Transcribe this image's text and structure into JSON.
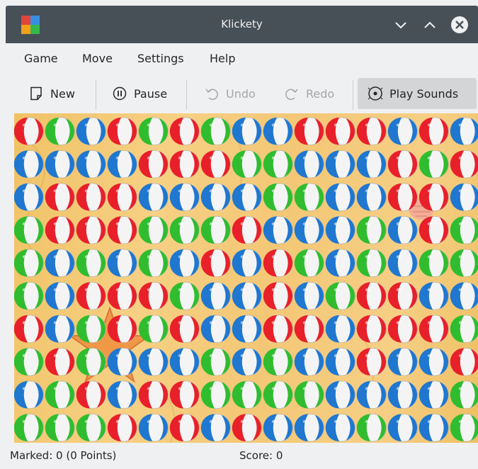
{
  "window": {
    "title": "Klickety",
    "titlebar_color": "#475057",
    "controls": [
      "minimize-icon",
      "maximize-icon",
      "close-icon"
    ]
  },
  "menubar": {
    "items": [
      {
        "label": "Game"
      },
      {
        "label": "Move"
      },
      {
        "label": "Settings"
      },
      {
        "label": "Help"
      }
    ]
  },
  "toolbar": {
    "new_label": "New",
    "new_icon": "new-document-icon",
    "pause_label": "Pause",
    "pause_icon": "pause-icon",
    "undo_label": "Undo",
    "undo_icon": "undo-icon",
    "undo_enabled": false,
    "redo_label": "Redo",
    "redo_icon": "redo-icon",
    "redo_enabled": false,
    "sounds_label": "Play Sounds",
    "sounds_icon": "speaker-icon",
    "sounds_checked": true
  },
  "board": {
    "columns": 15,
    "rows": 10,
    "background": "sand",
    "colors": {
      "R": "#e8202a",
      "G": "#2fbd2f",
      "B": "#1f77d0"
    },
    "grid": [
      "RGBRGRGBBRRRBRB",
      "BBBBRRRGGBBBRGR",
      "BRRRBBBBGGBBRRB",
      "GRRRGGGRBBBGBRG",
      "GBGBGBRBRGBGBGG",
      "GBRRRGBBRBGRRBB",
      "RBGRGRBBRRBRRRG",
      "GRGBBBGBGBBRBBR",
      "BGRBRRGGGGBBBBG",
      "GGGRBRBRBBBGBBG"
    ]
  },
  "status": {
    "marked": "Marked: 0 (0 Points)",
    "score": "Score: 0"
  }
}
